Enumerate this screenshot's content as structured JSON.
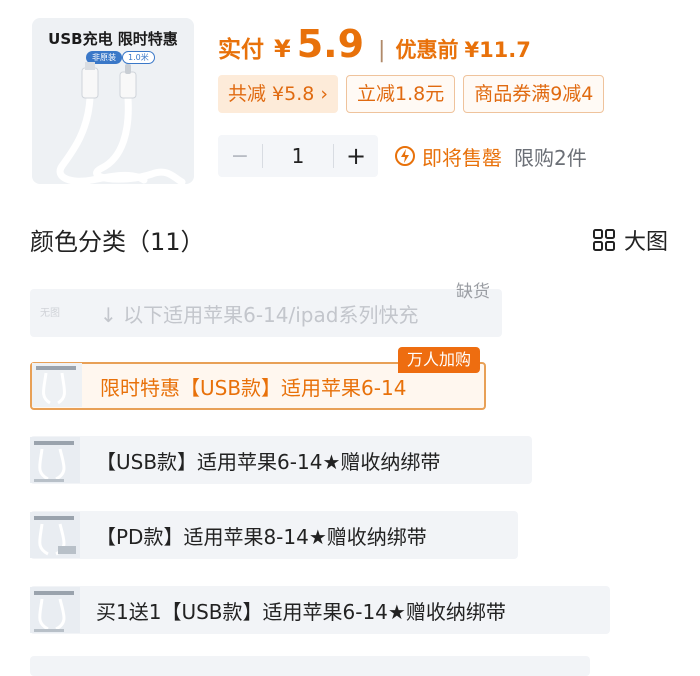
{
  "product": {
    "thumb_title": "USB充电 限时特惠",
    "thumb_tag": "非原装",
    "thumb_tag2": "1.0米",
    "price_label": "实付",
    "currency": "¥",
    "price": "5.9",
    "separator": "|",
    "orig_label": "优惠前",
    "orig_price": "¥11.7"
  },
  "discounts": {
    "total": "共减 ¥5.8 ›",
    "instant": "立减1.8元",
    "coupon": "商品券满9减4"
  },
  "quantity": {
    "minus": "−",
    "value": "1",
    "plus": "+"
  },
  "stock": {
    "status": "即将售罄",
    "limit": "限购2件"
  },
  "section": {
    "title": "颜色分类（11）",
    "view_label": "大图"
  },
  "options": [
    {
      "label": "↓ 以下适用苹果6-14/ipad系列快充",
      "img_tag": "无图",
      "badge": "缺货"
    },
    {
      "label": "限时特惠【USB款】适用苹果6-14",
      "badge": "万人加购"
    },
    {
      "label": "【USB款】适用苹果6-14★赠收纳绑带"
    },
    {
      "label": "【PD款】适用苹果8-14★赠收纳绑带"
    },
    {
      "label": "买1送1【USB款】适用苹果6-14★赠收纳绑带"
    }
  ],
  "colors": {
    "accent": "#e8710a",
    "accent_light": "#fdebd9",
    "option_bg": "#f2f4f7"
  },
  "icons": {
    "stock": "lightning-circle-icon",
    "view": "grid-icon"
  }
}
